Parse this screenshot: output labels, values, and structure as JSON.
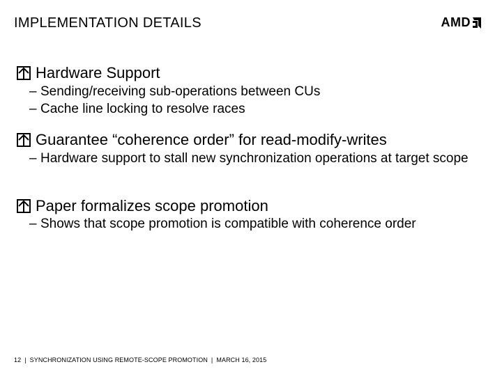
{
  "title": "IMPLEMENTATION DETAILS",
  "logo": {
    "text": "AMD"
  },
  "sections": [
    {
      "heading": "Hardware Support",
      "subs": [
        "Sending/receiving sub-operations between CUs",
        "Cache line locking to resolve races"
      ]
    },
    {
      "heading": "Guarantee “coherence order” for read-modify-writes",
      "subs": [
        "Hardware support to stall new synchronization operations at target scope"
      ]
    },
    {
      "heading": "Paper formalizes scope promotion",
      "subs": [
        "Shows that scope promotion is compatible with coherence order"
      ]
    }
  ],
  "footer": {
    "page": "12",
    "deck": "SYNCHRONIZATION USING REMOTE-SCOPE PROMOTION",
    "date": "MARCH 16, 2015"
  },
  "glyphs": {
    "dash": "‒"
  }
}
